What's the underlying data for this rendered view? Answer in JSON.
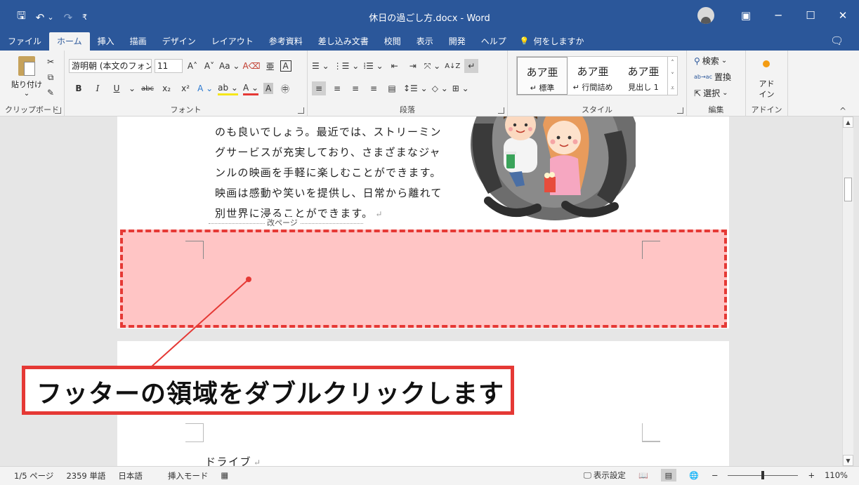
{
  "titlebar": {
    "qat_save_icon": "save-icon",
    "qat_undo_icon": "undo-icon",
    "qat_redo_icon": "redo-icon",
    "qat_save": "🖫",
    "qat_undo": "↶",
    "qat_undo_dropdown": "⌄",
    "qat_redo": "↷",
    "qat_customize": "₹",
    "title": "休日の過ごし方.docx  -  Word",
    "ribbon_display_icon": "▣",
    "minimize": "─",
    "maximize": "☐",
    "close": "✕",
    "bg_color": "#2b579a"
  },
  "tabs": {
    "items": [
      "ファイル",
      "ホーム",
      "挿入",
      "描画",
      "デザイン",
      "レイアウト",
      "参考資料",
      "差し込み文書",
      "校閲",
      "表示",
      "開発",
      "ヘルプ"
    ],
    "active_index": 1,
    "tell_me": "何をしますか",
    "tell_me_icon": "💡",
    "share_icon": "🗨"
  },
  "ribbon": {
    "clipboard": {
      "paste": "貼り付け",
      "paste_arrow": "⌄",
      "cut": "✂",
      "copy": "⧉",
      "format_painter": "✎",
      "label": "クリップボード"
    },
    "font": {
      "font_name": "游明朝 (本文のフォン",
      "font_size": "11",
      "grow": "A˄",
      "shrink": "A˅",
      "change_case": "Aa ⌄",
      "clear_format": "A⌫",
      "phonetic": "亜",
      "border_char": "A",
      "bold": "B",
      "italic": "I",
      "underline": "U",
      "underline_dd": "⌄",
      "strike": "abc",
      "subscript": "x₂",
      "superscript": "x²",
      "text_effect": "A ⌄",
      "highlight": "ab ⌄",
      "font_color": "A ⌄",
      "char_shade": "A",
      "enclosed": "㊥",
      "label": "フォント"
    },
    "paragraph": {
      "bullets": "☰ ⌄",
      "numbering": "⋮☰ ⌄",
      "multilevel": "⁞☰ ⌄",
      "decrease_indent": "⇤",
      "increase_indent": "⇥",
      "cjk_layout": "⤧ ⌄",
      "sort": "A↓Z",
      "show_marks": "↵",
      "align_left": "≡",
      "align_center": "≡",
      "align_right": "≡",
      "justify": "≡",
      "distributed": "▤",
      "line_spacing": "↕☰ ⌄",
      "shading": "◇ ⌄",
      "borders": "⊞ ⌄",
      "label": "段落"
    },
    "styles": {
      "items": [
        {
          "sample": "あア亜",
          "name": "↵ 標準"
        },
        {
          "sample": "あア亜",
          "name": "↵ 行間詰め"
        },
        {
          "sample": "あア亜",
          "name": "見出し 1"
        }
      ],
      "label": "スタイル"
    },
    "editing": {
      "find": "検索",
      "find_icon": "⚲",
      "find_dd": "⌄",
      "replace": "置換",
      "replace_icon": "ab→ac",
      "select": "選択",
      "select_icon": "⇱",
      "select_dd": "⌄",
      "label": "編集"
    },
    "addins": {
      "button": "アド\nイン",
      "label": "アドイン"
    },
    "collapse_icon": "^"
  },
  "document": {
    "page1_lines": [
      "のも良いでしょう。最近では、ストリーミン",
      "グサービスが充実しており、さまざまなジャ",
      "ンルの映画を手軽に楽しむことができます。",
      "映画は感動や笑いを提供し、日常から離れて",
      "別世界に浸ることができます。"
    ],
    "para_mark": "↵",
    "page_break": "改ページ",
    "page2_heading": "ドライブ",
    "highlight_color": "#e53935"
  },
  "callout": {
    "text": "フッターの領域をダブルクリックします"
  },
  "statusbar": {
    "page": "1/5 ページ",
    "words": "2359 単語",
    "language": "日本語",
    "mode": "挿入モード",
    "macro_icon": "▦",
    "display_settings": "表示設定",
    "display_settings_icon": "🖵",
    "view_read": "📖",
    "view_print": "▤",
    "view_web": "🌐",
    "zoom_out": "−",
    "zoom_in": "+",
    "zoom": "110%",
    "zoom_level_fraction": 0.5
  }
}
